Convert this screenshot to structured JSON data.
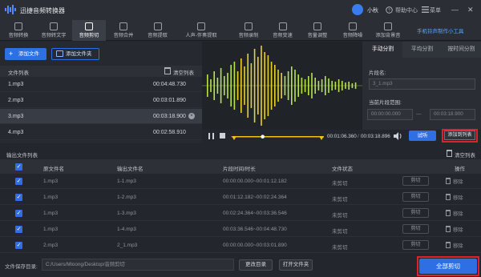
{
  "window": {
    "app_title": "迅捷音频转换器",
    "user_name": "小秋",
    "help_label": "帮助中心",
    "menu_label": "菜单",
    "minimize_glyph": "—",
    "close_glyph": "✕"
  },
  "toolbar": {
    "items": [
      {
        "label": "音频转换",
        "icon": "music-convert-icon"
      },
      {
        "label": "音频转文字",
        "icon": "audio-to-text-icon"
      },
      {
        "label": "音频剪切",
        "icon": "scissors-icon"
      },
      {
        "label": "音频合并",
        "icon": "merge-icon"
      },
      {
        "label": "音频提取",
        "icon": "extract-icon"
      },
      {
        "label": "人声-伴奏提取",
        "icon": "vocal-icon"
      },
      {
        "label": "音频录制",
        "icon": "record-icon"
      },
      {
        "label": "音频变速",
        "icon": "speed-icon"
      },
      {
        "label": "音量调整",
        "icon": "volume-icon"
      },
      {
        "label": "音频降噪",
        "icon": "denoise-icon"
      },
      {
        "label": "添加背景音",
        "icon": "bg-music-icon"
      }
    ],
    "active_index": 2,
    "phone_tool_label": "手机铃声制作小工具"
  },
  "file_panel": {
    "add_file_label": "添加文件",
    "add_folder_label": "添加文件夹",
    "list_header": "文件列表",
    "clear_label": "清空列表",
    "files": [
      {
        "name": "1.mp3",
        "duration": "00:04:48.730"
      },
      {
        "name": "2.mp3",
        "duration": "00:03:01.890"
      },
      {
        "name": "3.mp3",
        "duration": "00:03:18.900"
      },
      {
        "name": "4.mp3",
        "duration": "00:02:58.910"
      }
    ],
    "selected_index": 2
  },
  "player": {
    "current_time": "00:01:06.360",
    "total_time": "00:03:18.896",
    "play_position": 0.33,
    "trial_label": "试听",
    "add_to_list_label": "添加到列表",
    "colors": {
      "wave_green": "#b7e44a",
      "wave_yellow": "#e8d12a",
      "selection": "#f0c419"
    }
  },
  "split_panel": {
    "tabs": [
      "手动分割",
      "平均分割",
      "按时间分割"
    ],
    "active_tab": 0,
    "segment_name_label": "片段名:",
    "segment_name_placeholder": "3_1.mp3",
    "range_label": "当前片段范围:",
    "range_start": "00:00:00.000",
    "range_end": "00:03:18.900",
    "range_sep": "—"
  },
  "output": {
    "header": "输出文件列表",
    "clear_label": "清空列表",
    "columns": [
      "原文件名",
      "输出文件名",
      "片段时间/时长",
      "文件状态",
      "操作"
    ],
    "rows": [
      {
        "src": "1.mp3",
        "out": "1-1.mp3",
        "range": "00:00:00.000~00:01:12.182",
        "status": "未剪切"
      },
      {
        "src": "1.mp3",
        "out": "1-2.mp3",
        "range": "00:01:12.182~00:02:24.364",
        "status": "未剪切"
      },
      {
        "src": "1.mp3",
        "out": "1-3.mp3",
        "range": "00:02:24.364~00:03:36.546",
        "status": "未剪切"
      },
      {
        "src": "1.mp3",
        "out": "1-4.mp3",
        "range": "00:03:36.546~00:04:48.730",
        "status": "未剪切"
      },
      {
        "src": "2.mp3",
        "out": "2_1.mp3",
        "range": "00:00:00.000~00:03:01.890",
        "status": "未剪切"
      }
    ],
    "cut_label": "剪切",
    "remove_label": "移除"
  },
  "bottom": {
    "save_dir_label": "文件保存目录:",
    "save_dir_value": "C:/Users/Mloong/Desktop/音频剪切",
    "change_dir_label": "更改目录",
    "open_folder_label": "打开文件夹",
    "cut_all_label": "全部剪切"
  },
  "accent": {
    "blue": "#2f6fe4",
    "highlight_red": "#e0202a"
  }
}
